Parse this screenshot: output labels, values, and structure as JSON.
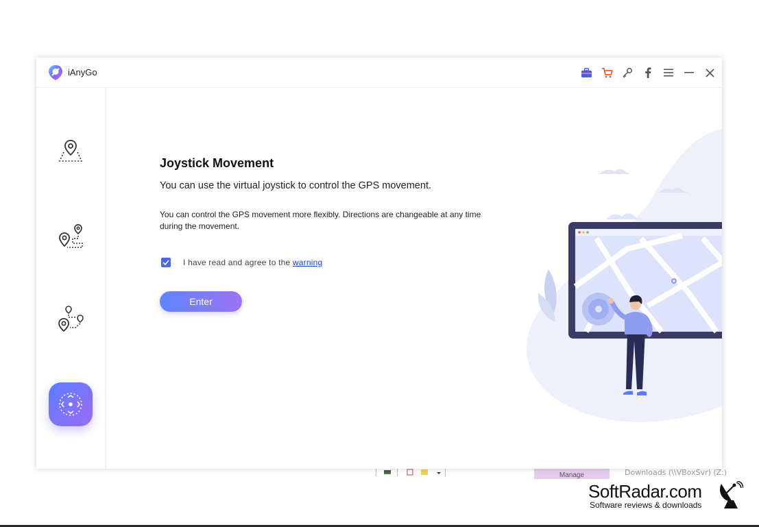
{
  "app": {
    "name": "iAnyGo"
  },
  "titlebar": {
    "icons": [
      "toolbox-icon",
      "cart-icon",
      "key-icon",
      "facebook-icon",
      "menu-icon",
      "minimize-icon",
      "close-icon"
    ]
  },
  "sidebar": {
    "items": [
      {
        "name": "change-location",
        "icon": "location-pin-area-icon"
      },
      {
        "name": "single-spot-movement",
        "icon": "two-spot-route-icon"
      },
      {
        "name": "multi-spot-movement",
        "icon": "multi-spot-route-icon"
      },
      {
        "name": "joystick-movement",
        "icon": "joystick-icon",
        "active": true
      }
    ]
  },
  "main": {
    "title": "Joystick Movement",
    "subtitle": "You can use the virtual joystick to control the GPS movement.",
    "description": "You can control the GPS movement more flexibly. Directions are changeable at any time during the movement.",
    "agree_text": "I have read and agree to the ",
    "agree_link": "warning",
    "agree_checked": true,
    "enter_label": "Enter"
  },
  "background": {
    "manage_label": "Manage",
    "downloads_label": "Downloads (\\\\VBoxSvr) (Z:)"
  },
  "watermark": {
    "title": "SoftRadar.com",
    "subtitle": "Software reviews & downloads"
  },
  "colors": {
    "accent_start": "#5e86ff",
    "accent_end": "#9c73f3",
    "checkbox": "#4b68e9",
    "link": "#1a3fcc",
    "cart": "#f25a1d"
  }
}
